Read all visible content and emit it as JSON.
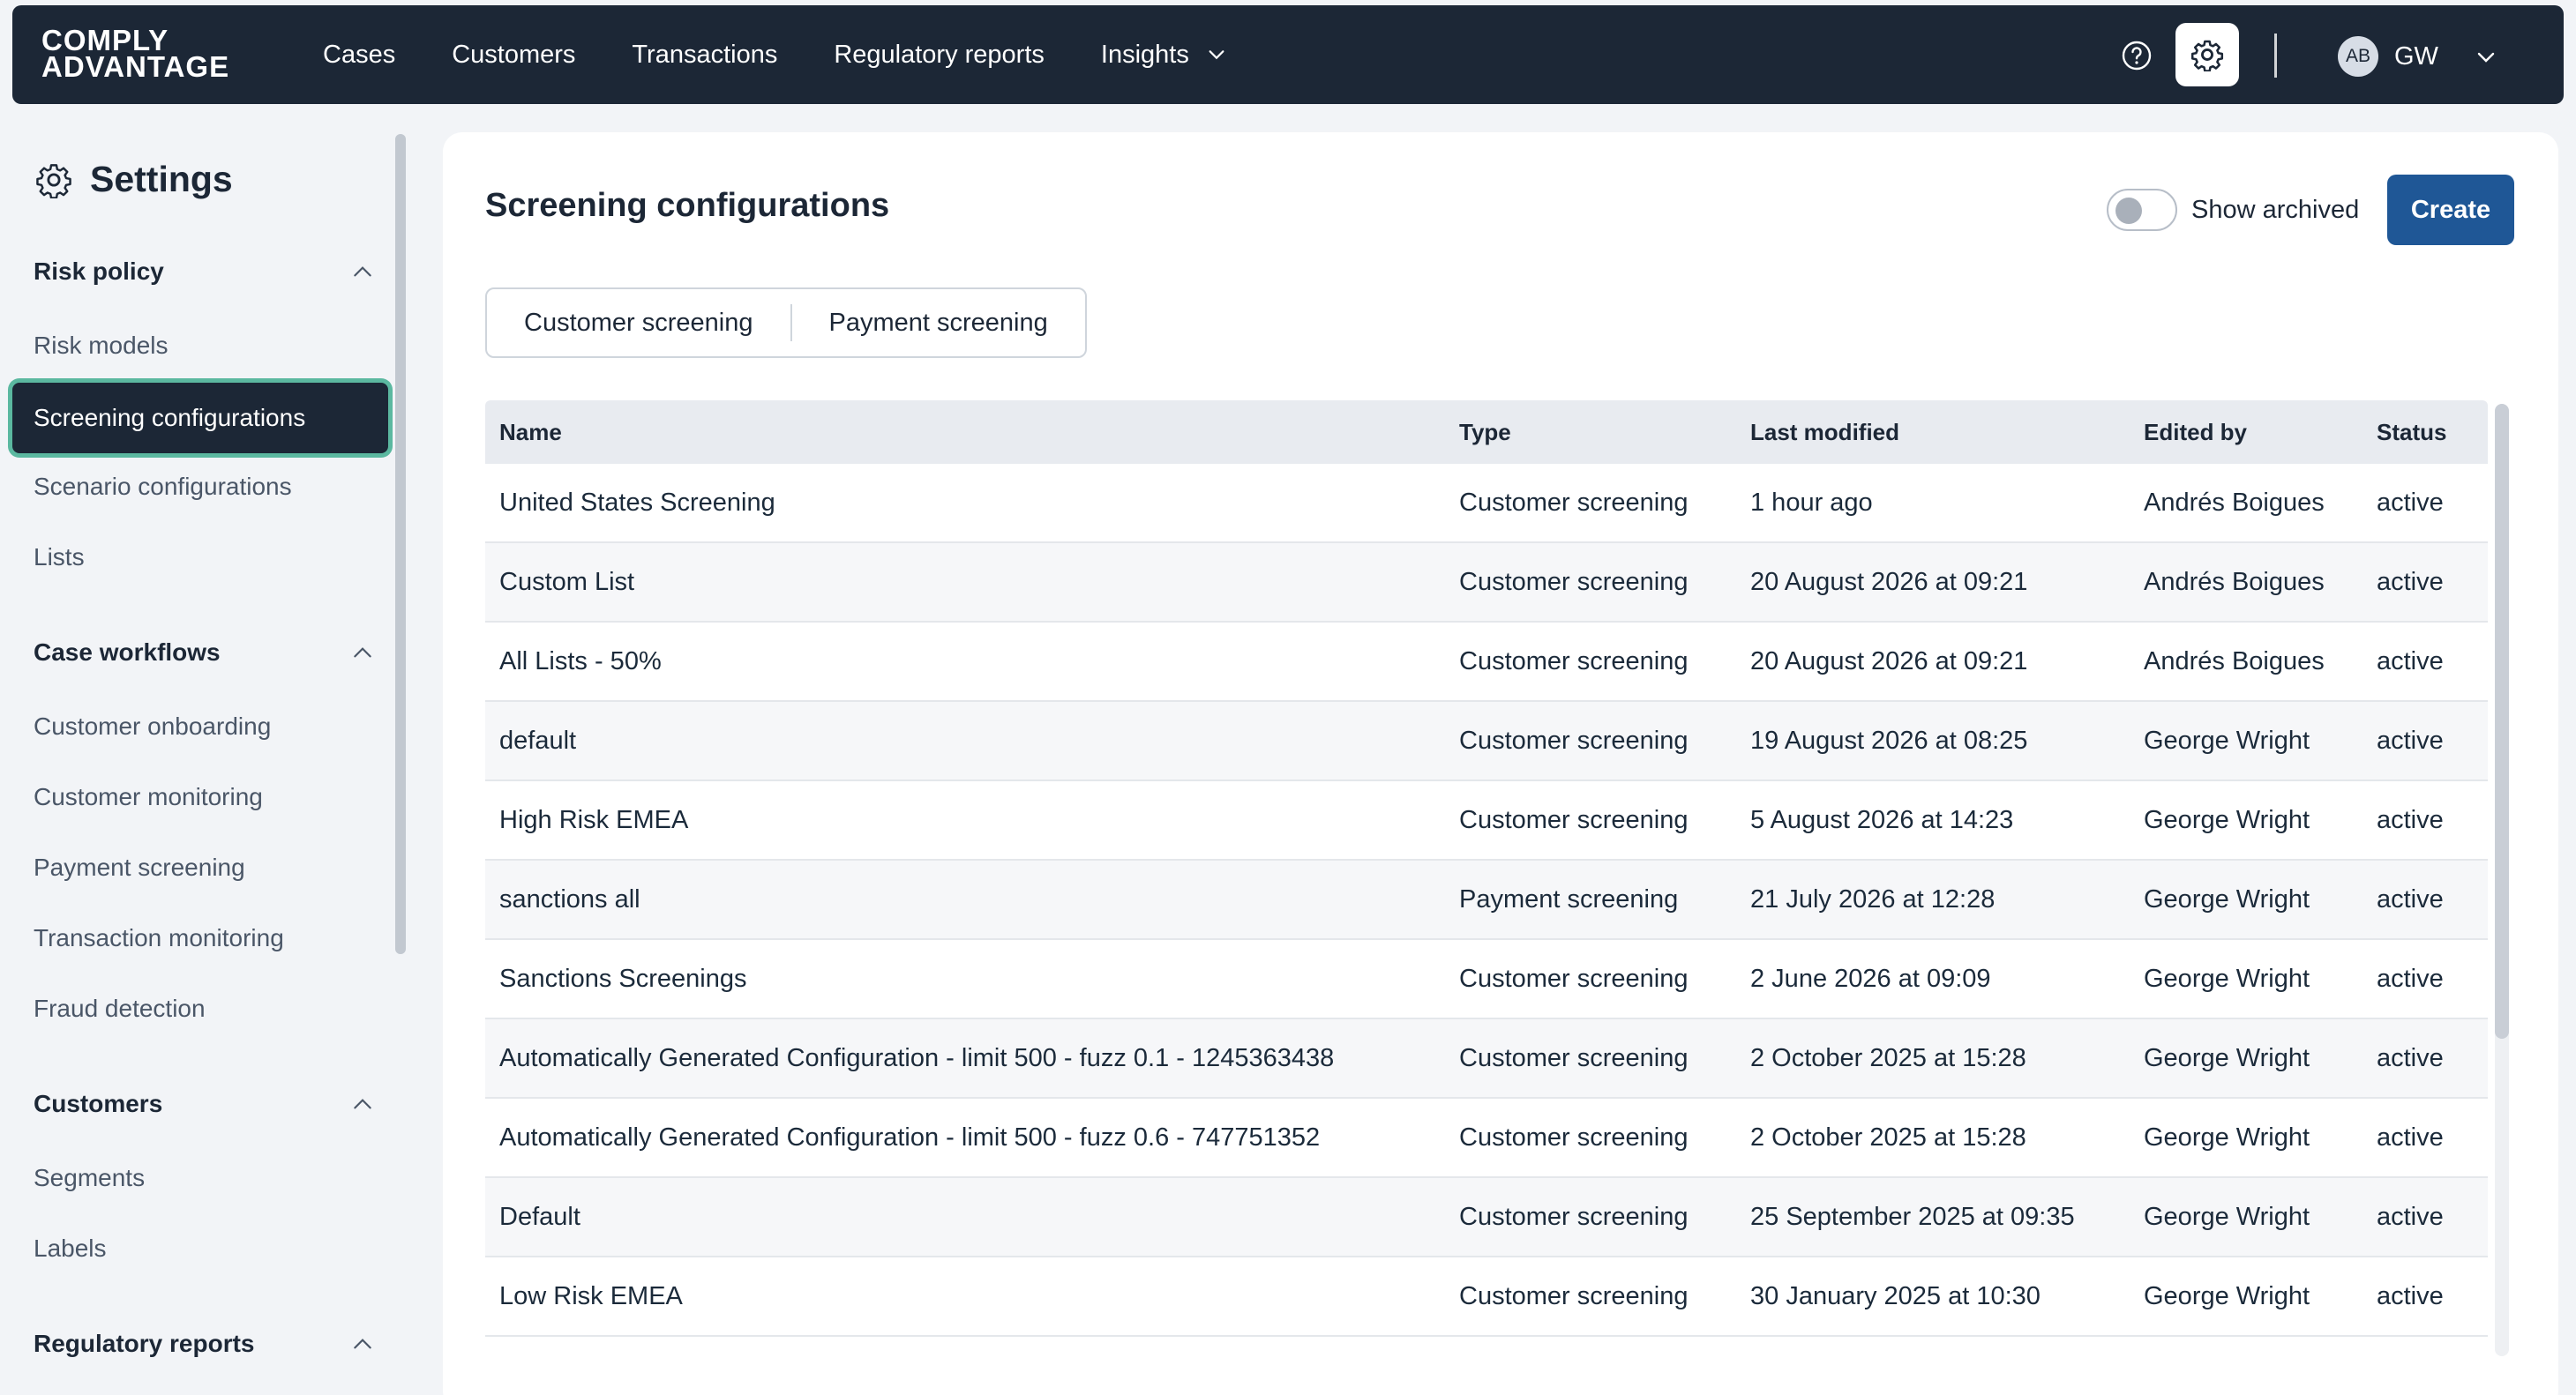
{
  "nav": {
    "logo_line1": "COMPLY",
    "logo_line2": "ADVANTAGE",
    "items": [
      {
        "label": "Cases"
      },
      {
        "label": "Customers"
      },
      {
        "label": "Transactions"
      },
      {
        "label": "Regulatory reports"
      },
      {
        "label": "Insights"
      }
    ],
    "avatar": "AB",
    "user_initials": "GW",
    "icons": [
      "help-icon",
      "gear-icon",
      "chevron-down-icon"
    ]
  },
  "sidebar": {
    "title": "Settings",
    "groups": [
      {
        "label": "Risk policy",
        "items": [
          "Risk models",
          "Screening configurations",
          "Scenario configurations",
          "Lists"
        ]
      },
      {
        "label": "Case workflows",
        "items": [
          "Customer onboarding",
          "Customer monitoring",
          "Payment screening",
          "Transaction monitoring",
          "Fraud detection"
        ]
      },
      {
        "label": "Customers",
        "items": [
          "Segments",
          "Labels"
        ]
      },
      {
        "label": "Regulatory reports",
        "items": []
      }
    ],
    "active_item": "Screening configurations"
  },
  "main": {
    "title": "Screening configurations",
    "show_archived_label": "Show archived",
    "create_label": "Create",
    "tabs": [
      "Customer screening",
      "Payment screening"
    ],
    "columns": [
      "Name",
      "Type",
      "Last modified",
      "Edited by",
      "Status"
    ],
    "rows": [
      {
        "name": "United States Screening",
        "type": "Customer screening",
        "modified": "1 hour ago",
        "editor": "Andrés Boigues",
        "status": "active"
      },
      {
        "name": "Custom List",
        "type": "Customer screening",
        "modified": "20 August 2026 at 09:21",
        "editor": "Andrés Boigues",
        "status": "active"
      },
      {
        "name": "All Lists - 50%",
        "type": "Customer screening",
        "modified": "20 August 2026 at 09:21",
        "editor": "Andrés Boigues",
        "status": "active"
      },
      {
        "name": "default",
        "type": "Customer screening",
        "modified": "19 August 2026 at 08:25",
        "editor": "George Wright",
        "status": "active"
      },
      {
        "name": "High Risk EMEA",
        "type": "Customer screening",
        "modified": "5 August 2026 at 14:23",
        "editor": "George Wright",
        "status": "active"
      },
      {
        "name": "sanctions all",
        "type": "Payment screening",
        "modified": "21 July 2026 at 12:28",
        "editor": "George Wright",
        "status": "active"
      },
      {
        "name": "Sanctions Screenings",
        "type": "Customer screening",
        "modified": "2 June 2026 at 09:09",
        "editor": "George Wright",
        "status": "active"
      },
      {
        "name": "Automatically Generated Configuration - limit 500 - fuzz 0.1 - 1245363438",
        "type": "Customer screening",
        "modified": "2 October 2025 at 15:28",
        "editor": "George Wright",
        "status": "active"
      },
      {
        "name": "Automatically Generated Configuration - limit 500 - fuzz 0.6 - 747751352",
        "type": "Customer screening",
        "modified": "2 October 2025 at 15:28",
        "editor": "George Wright",
        "status": "active"
      },
      {
        "name": "Default",
        "type": "Customer screening",
        "modified": "25 September 2025 at 09:35",
        "editor": "George Wright",
        "status": "active"
      },
      {
        "name": "Low Risk EMEA",
        "type": "Customer screening",
        "modified": "30 January 2025 at 10:30",
        "editor": "George Wright",
        "status": "active"
      }
    ]
  },
  "colors": {
    "nav_bg": "#1c2736",
    "primary_button": "#1f5796",
    "active_outline": "#5bb8a0"
  }
}
